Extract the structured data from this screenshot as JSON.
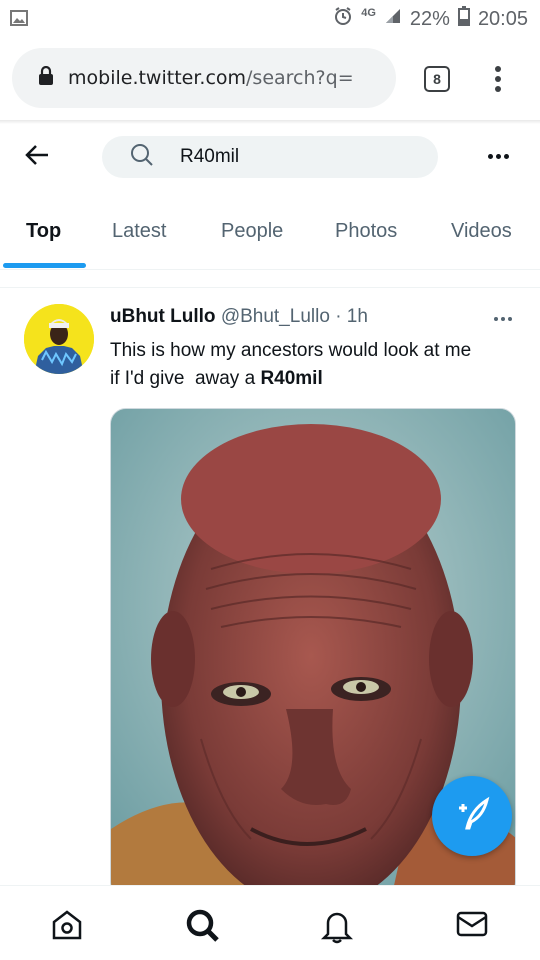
{
  "status_bar": {
    "network": "4G",
    "battery": "22%",
    "time": "20:05"
  },
  "browser": {
    "url_domain": "mobile.twitter.com",
    "url_path": "/search?q=",
    "tab_count": "8"
  },
  "search": {
    "query": "R40mil"
  },
  "tabs": [
    {
      "label": "Top",
      "active": true
    },
    {
      "label": "Latest",
      "active": false
    },
    {
      "label": "People",
      "active": false
    },
    {
      "label": "Photos",
      "active": false
    },
    {
      "label": "Videos",
      "active": false
    }
  ],
  "tweet": {
    "display_name": "uBhut Lullo",
    "handle": "@Bhut_Lullo",
    "separator": "·",
    "time": "1h",
    "text_line1": "This is how my ancestors would look at me",
    "text_line2_prefix": "if I'd give  away a ",
    "text_highlight": "R40mil"
  },
  "colors": {
    "accent": "#1d9bf0",
    "text_primary": "#0f1419",
    "text_secondary": "#536471"
  },
  "icons": [
    "lock-icon",
    "back-arrow-icon",
    "search-icon",
    "more-icon",
    "compose-tweet-icon",
    "home-icon",
    "explore-search-icon",
    "notifications-bell-icon",
    "messages-mail-icon"
  ]
}
